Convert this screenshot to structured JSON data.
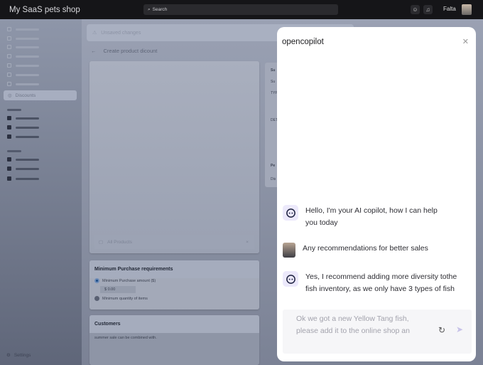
{
  "topbar": {
    "app_title": "My SaaS pets shop",
    "search_placeholder": "Search",
    "user_name": "Falta"
  },
  "sidebar": {
    "active_item": "Discounts",
    "settings": "Settings"
  },
  "main": {
    "unsaved_label": "Unsaved changes",
    "page_title": "Create product dicount",
    "all_products": "All Products",
    "min_purchase": {
      "title": "Minimum Purchase requirements",
      "option_amount": "Minimum Purchase amount ($)",
      "amount_value": "$ 0.00",
      "option_quantity": "Minimum quantity of items"
    },
    "customers": {
      "title": "Customers",
      "text": "summer sale can be combined with."
    },
    "right_card_fragments": [
      "Su",
      "Su",
      "TYP",
      "DET",
      "Pe",
      "Dis"
    ]
  },
  "chat": {
    "title": "opencopilot",
    "messages": [
      {
        "role": "bot",
        "text": "Hello, I'm your AI copilot, how I can help you today"
      },
      {
        "role": "user",
        "text": "Any recommendations for better sales"
      },
      {
        "role": "bot",
        "text": "Yes, I recommend adding more diversity tothe fish inventory, as we only have 3 types of fish"
      }
    ],
    "input_value": "Ok we got a new Yellow Tang fish, please add it to the online shop an"
  }
}
